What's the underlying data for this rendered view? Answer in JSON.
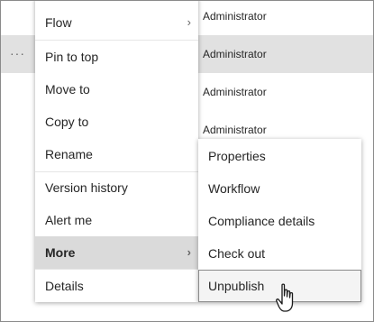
{
  "rows": [
    {
      "modified_by": "Administrator"
    },
    {
      "modified_by": "Administrator",
      "more": "···"
    },
    {
      "modified_by": "Administrator"
    },
    {
      "modified_by": "Administrator"
    }
  ],
  "menu": {
    "items": [
      {
        "label": "Flow",
        "chevron": "›"
      },
      {
        "label": "Pin to top"
      },
      {
        "label": "Move to"
      },
      {
        "label": "Copy to"
      },
      {
        "label": "Rename"
      },
      {
        "label": "Version history"
      },
      {
        "label": "Alert me"
      },
      {
        "label": "More",
        "chevron": "›"
      },
      {
        "label": "Details"
      }
    ]
  },
  "submenu": {
    "items": [
      {
        "label": "Properties"
      },
      {
        "label": "Workflow"
      },
      {
        "label": "Compliance details"
      },
      {
        "label": "Check out"
      },
      {
        "label": "Unpublish"
      }
    ]
  },
  "icons": {
    "cursor": "hand-pointer-icon"
  }
}
